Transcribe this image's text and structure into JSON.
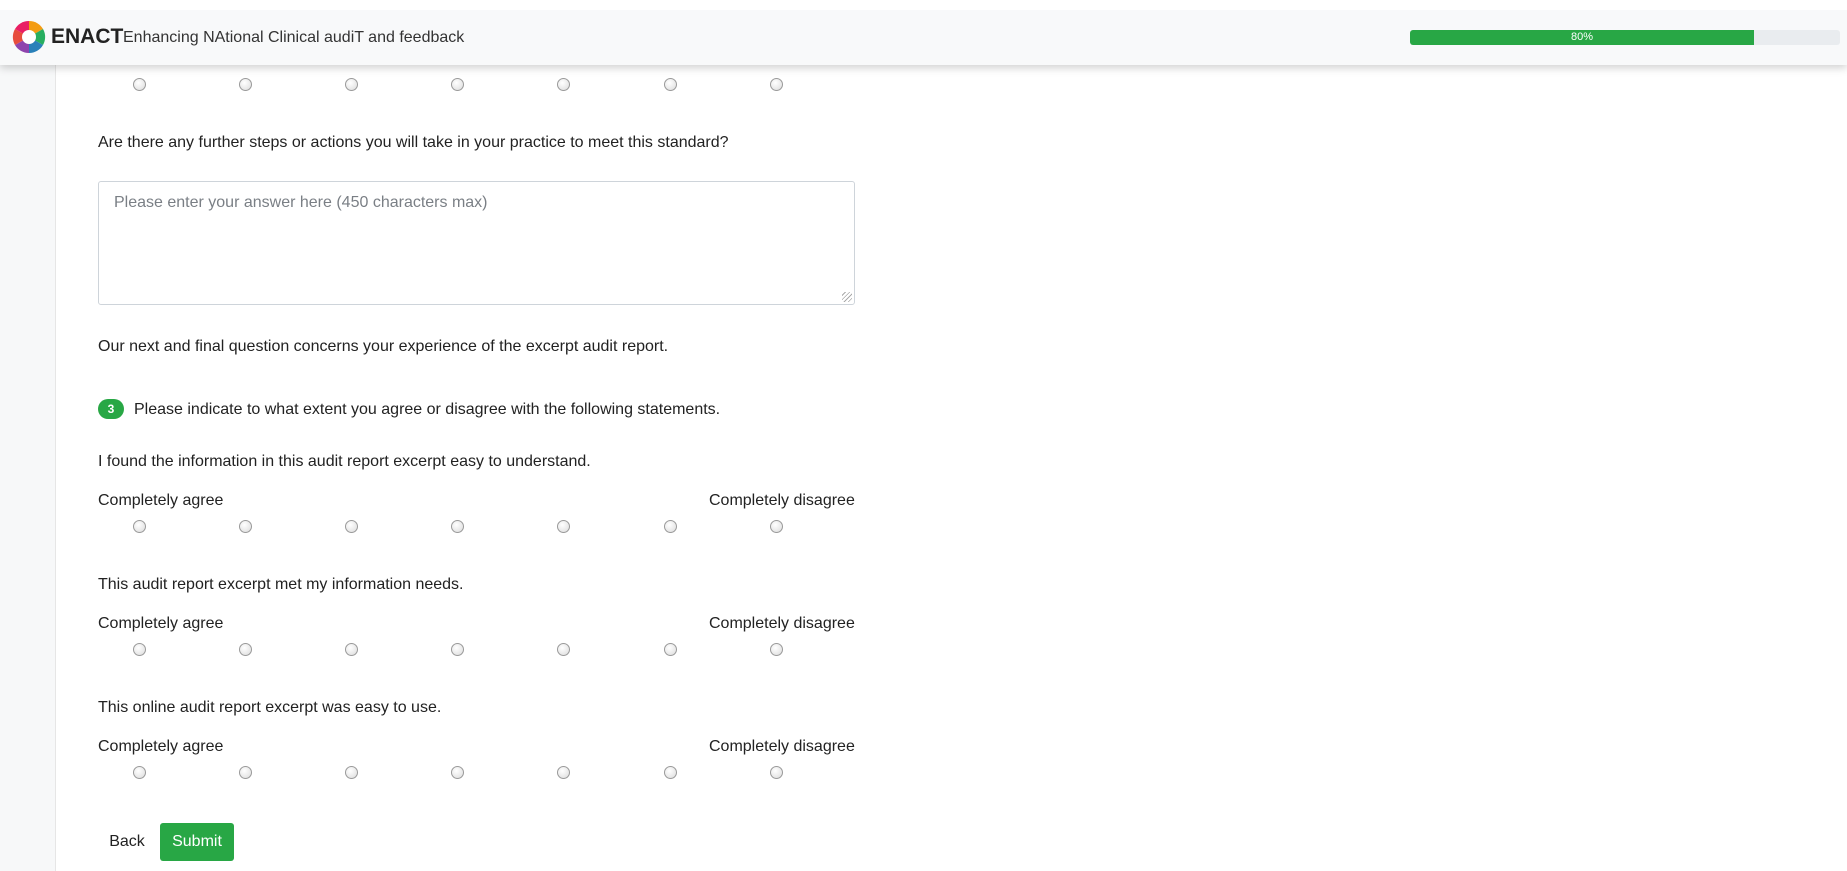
{
  "header": {
    "brand": "ENACT",
    "tagline": "Enhancing NAtional Clinical audiT and feedback",
    "progress_value": 80,
    "progress_label": "80%",
    "accent_color": "#28a745"
  },
  "previous_scale": {
    "options": 7
  },
  "further_steps": {
    "question": "Are there any further steps or actions you will take in your practice to meet this standard?",
    "answer_value": "",
    "answer_placeholder": "Please enter your answer here (450 characters max)"
  },
  "intro": "Our next and final question concerns your experience of the excerpt audit report.",
  "question3": {
    "number": "3",
    "prompt": "Please indicate to what extent you agree or disagree with the following statements.",
    "statements": [
      {
        "text": "I found the information in this audit report excerpt easy to understand.",
        "left_label": "Completely agree",
        "right_label": "Completely disagree",
        "options": 7
      },
      {
        "text": "This audit report excerpt met my information needs.",
        "left_label": "Completely agree",
        "right_label": "Completely disagree",
        "options": 7
      },
      {
        "text": "This online audit report excerpt was easy to use.",
        "left_label": "Completely agree",
        "right_label": "Completely disagree",
        "options": 7
      }
    ]
  },
  "buttons": {
    "back_label": "Back",
    "submit_label": "Submit"
  }
}
